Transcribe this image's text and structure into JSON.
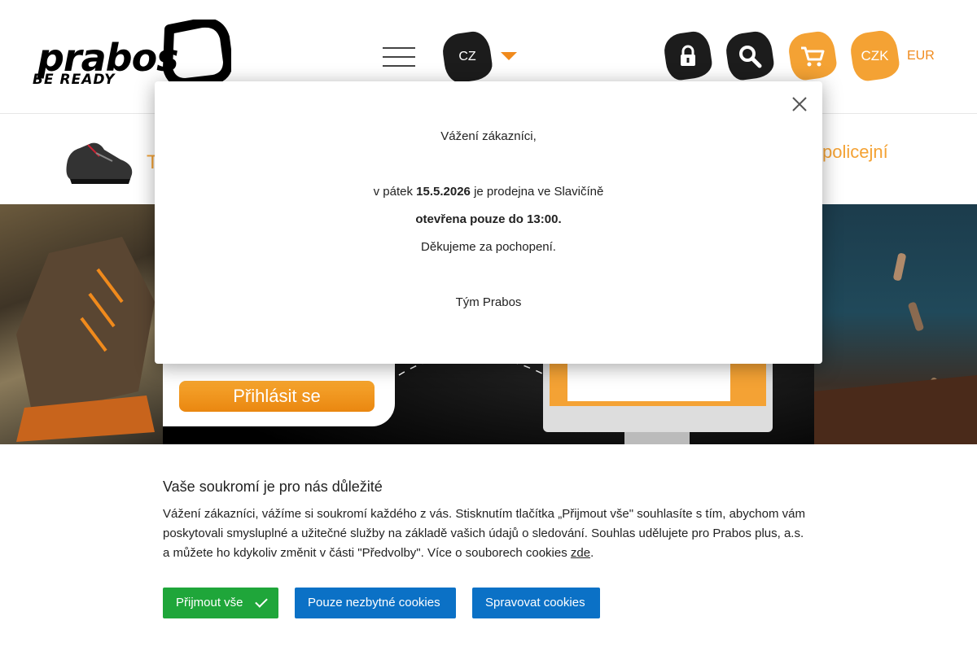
{
  "header": {
    "logo_word": "prabos",
    "logo_tagline": "BE READY",
    "language": "CZ",
    "currency_active": "CZK",
    "currency_alt": "EUR",
    "icons": [
      "menu-icon",
      "lock-icon",
      "search-icon",
      "cart-icon"
    ],
    "colors": {
      "accent": "#f4a234",
      "dark": "#1c1c1c"
    }
  },
  "promo_strip": {
    "left_text": "T",
    "right_text": "policejní"
  },
  "banner": {
    "login_label": "Přihlásit se"
  },
  "modal": {
    "greeting": "Vážení zákazníci,",
    "line_prefix": "v pátek ",
    "date": "15.5.2026",
    "line_suffix": " je prodejna ve Slavičíně",
    "hours": "otevřena pouze do 13:00.",
    "thanks": "Děkujeme za pochopení.",
    "signature": "Tým Prabos"
  },
  "cookie": {
    "title": "Vaše soukromí je pro nás důležité",
    "text": "Vážení zákazníci, vážíme si soukromí každého z vás. Stisknutím tlačítka „Přijmout vše\" souhlasíte s tím, abychom vám poskytovali smysluplné a užitečné služby na základě vašich údajů o sledování. Souhlas udělujete pro Prabos plus, a.s. a můžete ho kdykoliv změnit v části \"Předvolby\". Více o souborech cookies ",
    "link_text": "zde",
    "text_end": ".",
    "accept_label": "Přijmout vše",
    "necessary_label": "Pouze nezbytné cookies",
    "manage_label": "Spravovat cookies",
    "colors": {
      "accept": "#1fa63a",
      "secondary": "#0b71c6"
    }
  }
}
